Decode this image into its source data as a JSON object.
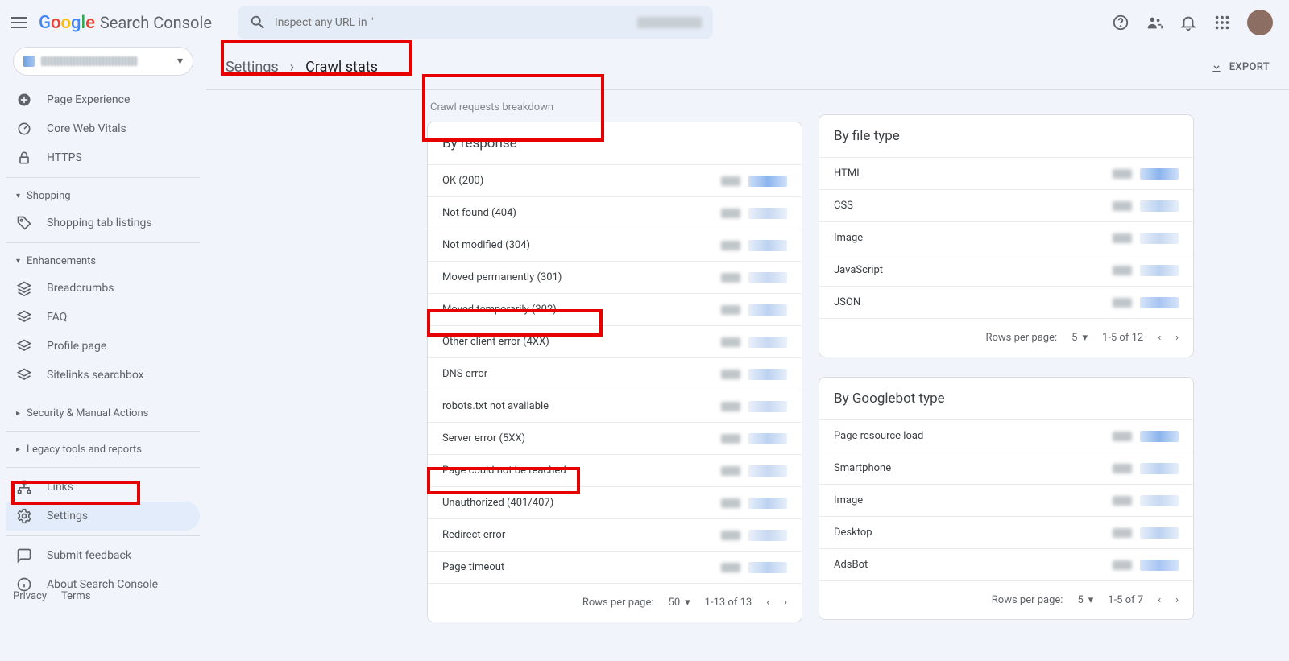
{
  "app_title": "Search Console",
  "search_placeholder": "Inspect any URL in \"",
  "breadcrumb": {
    "parent": "Settings",
    "current": "Crawl stats"
  },
  "export_label": "EXPORT",
  "section_label": "Crawl requests breakdown",
  "cards": {
    "by_response": {
      "title": "By response",
      "rows": [
        "OK (200)",
        "Not found (404)",
        "Not modified (304)",
        "Moved permanently (301)",
        "Moved temporarily (302)",
        "Other client error (4XX)",
        "DNS error",
        "robots.txt not available",
        "Server error (5XX)",
        "Page could not be reached",
        "Unauthorized (401/407)",
        "Redirect error",
        "Page timeout"
      ],
      "pager": {
        "label": "Rows per page:",
        "size": "50",
        "range": "1-13 of 13"
      }
    },
    "by_filetype": {
      "title": "By file type",
      "rows": [
        "HTML",
        "CSS",
        "Image",
        "JavaScript",
        "JSON"
      ],
      "pager": {
        "label": "Rows per page:",
        "size": "5",
        "range": "1-5 of 12"
      }
    },
    "by_googlebot": {
      "title": "By Googlebot type",
      "rows": [
        "Page resource load",
        "Smartphone",
        "Image",
        "Desktop",
        "AdsBot"
      ],
      "pager": {
        "label": "Rows per page:",
        "size": "5",
        "range": "1-5 of 7"
      }
    }
  },
  "sidebar": {
    "items_top": [
      "Page Experience",
      "Core Web Vitals",
      "HTTPS"
    ],
    "shopping_label": "Shopping",
    "shopping_item": "Shopping tab listings",
    "enh_label": "Enhancements",
    "enh_items": [
      "Breadcrumbs",
      "FAQ",
      "Profile page",
      "Sitelinks searchbox"
    ],
    "sec_label": "Security & Manual Actions",
    "legacy_label": "Legacy tools and reports",
    "links_label": "Links",
    "settings_label": "Settings",
    "feedback_label": "Submit feedback",
    "about_label": "About Search Console"
  },
  "footer": {
    "privacy": "Privacy",
    "terms": "Terms"
  }
}
